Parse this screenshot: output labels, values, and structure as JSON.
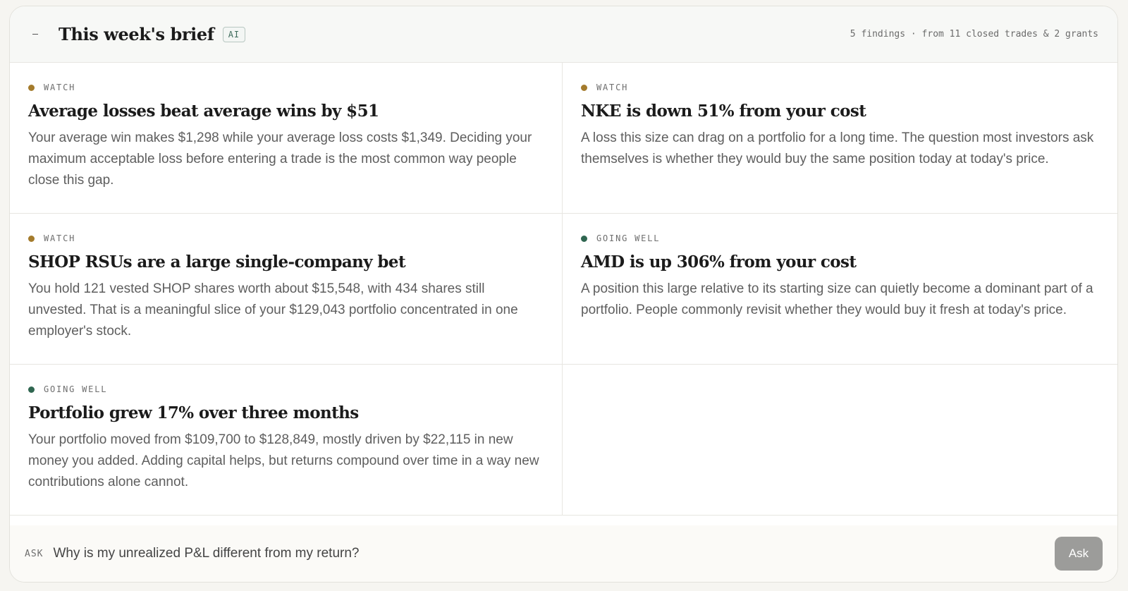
{
  "header": {
    "collapse_icon": "minus-icon",
    "title": "This week's brief",
    "badge": "AI",
    "meta": "5 findings · from 11 closed trades & 2 grants"
  },
  "colors": {
    "watch": "#a47b2c",
    "going_well": "#2f6650"
  },
  "findings": [
    {
      "status": "WATCH",
      "status_type": "watch",
      "title": "Average losses beat average wins by $51",
      "body": "Your average win makes $1,298 while your average loss costs $1,349. Deciding your maximum acceptable loss before entering a trade is the most common way people close this gap."
    },
    {
      "status": "WATCH",
      "status_type": "watch",
      "title": "NKE is down 51% from your cost",
      "body": "A loss this size can drag on a portfolio for a long time. The question most investors ask themselves is whether they would buy the same position today at today's price."
    },
    {
      "status": "WATCH",
      "status_type": "watch",
      "title": "SHOP RSUs are a large single-company bet",
      "body": "You hold 121 vested SHOP shares worth about $15,548, with 434 shares still unvested. That is a meaningful slice of your $129,043 portfolio concentrated in one employer's stock."
    },
    {
      "status": "GOING WELL",
      "status_type": "going_well",
      "title": "AMD is up 306% from your cost",
      "body": "A position this large relative to its starting size can quietly become a dominant part of a portfolio. People commonly revisit whether they would buy it fresh at today's price."
    },
    {
      "status": "GOING WELL",
      "status_type": "going_well",
      "title": "Portfolio grew 17% over three months",
      "body": "Your portfolio moved from $109,700 to $128,849, mostly driven by $22,115 in new money you added. Adding capital helps, but returns compound over time in a way new contributions alone cannot."
    }
  ],
  "ask": {
    "label": "ASK",
    "value": "Why is my unrealized P&L different from my return?",
    "button": "Ask"
  }
}
